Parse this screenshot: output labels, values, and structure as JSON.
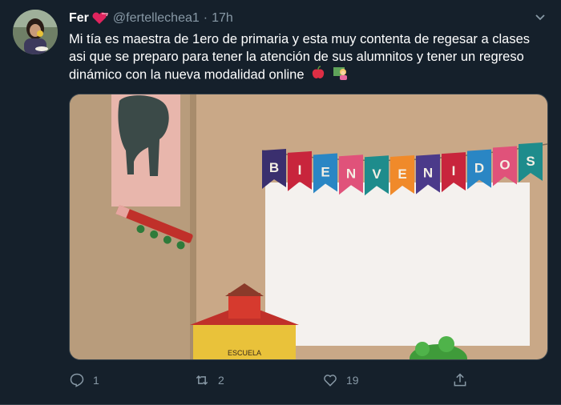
{
  "tweet": {
    "display_name": "Fer",
    "handle": "@fertellechea1",
    "separator": "·",
    "time": "17h",
    "text": "Mi tía es maestra de 1ero de primaria y esta muy contenta de regesar a clases asi que se preparo para tener la atención de sus alumnitos y tener un regreso dinámico con la nueva modalidad online",
    "emojis": [
      "apple-emoji",
      "teacher-emoji"
    ],
    "banner_letters": [
      "B",
      "I",
      "E",
      "N",
      "V",
      "E",
      "N",
      "I",
      "D",
      "O",
      "S"
    ],
    "banner_colors": [
      "#3a2f6e",
      "#c8253c",
      "#2a86c4",
      "#e0527a",
      "#1e8c8c",
      "#f08a2a",
      "#4b3a8a",
      "#c8253c",
      "#2a86c4",
      "#e0527a",
      "#1e8c8c"
    ],
    "sign_text": "ESCUELA"
  },
  "actions": {
    "reply_count": "1",
    "retweet_count": "2",
    "like_count": "19"
  },
  "colors": {
    "background": "#15202b",
    "secondary_text": "#8899a6",
    "border": "#38444d"
  }
}
